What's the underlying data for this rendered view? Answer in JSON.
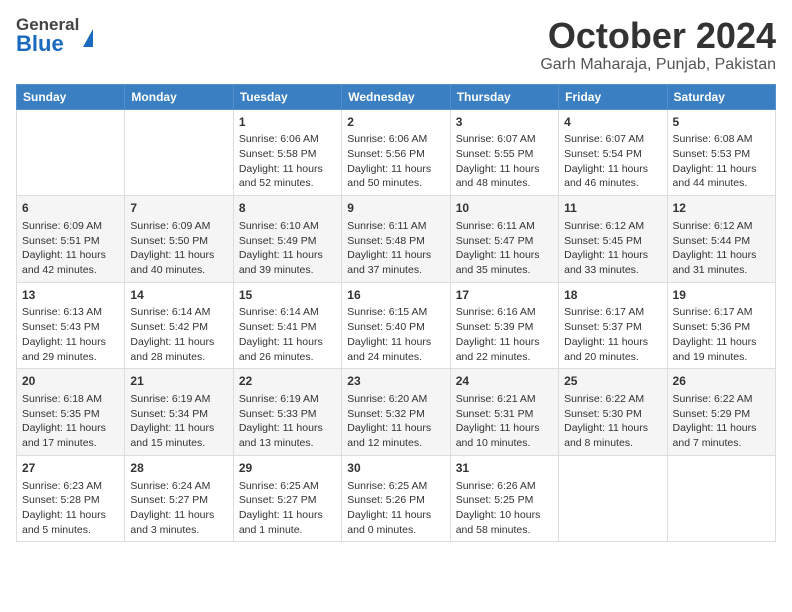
{
  "header": {
    "logo_general": "General",
    "logo_blue": "Blue",
    "month_title": "October 2024",
    "location": "Garh Maharaja, Punjab, Pakistan"
  },
  "weekdays": [
    "Sunday",
    "Monday",
    "Tuesday",
    "Wednesday",
    "Thursday",
    "Friday",
    "Saturday"
  ],
  "weeks": [
    [
      {
        "day": "",
        "info": ""
      },
      {
        "day": "",
        "info": ""
      },
      {
        "day": "1",
        "info": "Sunrise: 6:06 AM\nSunset: 5:58 PM\nDaylight: 11 hours and 52 minutes."
      },
      {
        "day": "2",
        "info": "Sunrise: 6:06 AM\nSunset: 5:56 PM\nDaylight: 11 hours and 50 minutes."
      },
      {
        "day": "3",
        "info": "Sunrise: 6:07 AM\nSunset: 5:55 PM\nDaylight: 11 hours and 48 minutes."
      },
      {
        "day": "4",
        "info": "Sunrise: 6:07 AM\nSunset: 5:54 PM\nDaylight: 11 hours and 46 minutes."
      },
      {
        "day": "5",
        "info": "Sunrise: 6:08 AM\nSunset: 5:53 PM\nDaylight: 11 hours and 44 minutes."
      }
    ],
    [
      {
        "day": "6",
        "info": "Sunrise: 6:09 AM\nSunset: 5:51 PM\nDaylight: 11 hours and 42 minutes."
      },
      {
        "day": "7",
        "info": "Sunrise: 6:09 AM\nSunset: 5:50 PM\nDaylight: 11 hours and 40 minutes."
      },
      {
        "day": "8",
        "info": "Sunrise: 6:10 AM\nSunset: 5:49 PM\nDaylight: 11 hours and 39 minutes."
      },
      {
        "day": "9",
        "info": "Sunrise: 6:11 AM\nSunset: 5:48 PM\nDaylight: 11 hours and 37 minutes."
      },
      {
        "day": "10",
        "info": "Sunrise: 6:11 AM\nSunset: 5:47 PM\nDaylight: 11 hours and 35 minutes."
      },
      {
        "day": "11",
        "info": "Sunrise: 6:12 AM\nSunset: 5:45 PM\nDaylight: 11 hours and 33 minutes."
      },
      {
        "day": "12",
        "info": "Sunrise: 6:12 AM\nSunset: 5:44 PM\nDaylight: 11 hours and 31 minutes."
      }
    ],
    [
      {
        "day": "13",
        "info": "Sunrise: 6:13 AM\nSunset: 5:43 PM\nDaylight: 11 hours and 29 minutes."
      },
      {
        "day": "14",
        "info": "Sunrise: 6:14 AM\nSunset: 5:42 PM\nDaylight: 11 hours and 28 minutes."
      },
      {
        "day": "15",
        "info": "Sunrise: 6:14 AM\nSunset: 5:41 PM\nDaylight: 11 hours and 26 minutes."
      },
      {
        "day": "16",
        "info": "Sunrise: 6:15 AM\nSunset: 5:40 PM\nDaylight: 11 hours and 24 minutes."
      },
      {
        "day": "17",
        "info": "Sunrise: 6:16 AM\nSunset: 5:39 PM\nDaylight: 11 hours and 22 minutes."
      },
      {
        "day": "18",
        "info": "Sunrise: 6:17 AM\nSunset: 5:37 PM\nDaylight: 11 hours and 20 minutes."
      },
      {
        "day": "19",
        "info": "Sunrise: 6:17 AM\nSunset: 5:36 PM\nDaylight: 11 hours and 19 minutes."
      }
    ],
    [
      {
        "day": "20",
        "info": "Sunrise: 6:18 AM\nSunset: 5:35 PM\nDaylight: 11 hours and 17 minutes."
      },
      {
        "day": "21",
        "info": "Sunrise: 6:19 AM\nSunset: 5:34 PM\nDaylight: 11 hours and 15 minutes."
      },
      {
        "day": "22",
        "info": "Sunrise: 6:19 AM\nSunset: 5:33 PM\nDaylight: 11 hours and 13 minutes."
      },
      {
        "day": "23",
        "info": "Sunrise: 6:20 AM\nSunset: 5:32 PM\nDaylight: 11 hours and 12 minutes."
      },
      {
        "day": "24",
        "info": "Sunrise: 6:21 AM\nSunset: 5:31 PM\nDaylight: 11 hours and 10 minutes."
      },
      {
        "day": "25",
        "info": "Sunrise: 6:22 AM\nSunset: 5:30 PM\nDaylight: 11 hours and 8 minutes."
      },
      {
        "day": "26",
        "info": "Sunrise: 6:22 AM\nSunset: 5:29 PM\nDaylight: 11 hours and 7 minutes."
      }
    ],
    [
      {
        "day": "27",
        "info": "Sunrise: 6:23 AM\nSunset: 5:28 PM\nDaylight: 11 hours and 5 minutes."
      },
      {
        "day": "28",
        "info": "Sunrise: 6:24 AM\nSunset: 5:27 PM\nDaylight: 11 hours and 3 minutes."
      },
      {
        "day": "29",
        "info": "Sunrise: 6:25 AM\nSunset: 5:27 PM\nDaylight: 11 hours and 1 minute."
      },
      {
        "day": "30",
        "info": "Sunrise: 6:25 AM\nSunset: 5:26 PM\nDaylight: 11 hours and 0 minutes."
      },
      {
        "day": "31",
        "info": "Sunrise: 6:26 AM\nSunset: 5:25 PM\nDaylight: 10 hours and 58 minutes."
      },
      {
        "day": "",
        "info": ""
      },
      {
        "day": "",
        "info": ""
      }
    ]
  ]
}
